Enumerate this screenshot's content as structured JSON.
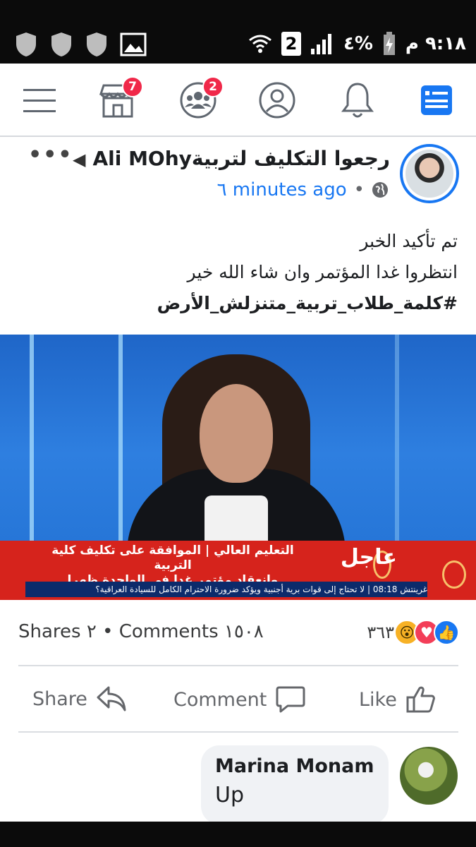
{
  "status_bar": {
    "time": "٩:١٨ م",
    "battery": "٤%",
    "sim": "2",
    "icons": [
      "shield-icon",
      "shield-icon",
      "shield-icon",
      "image-icon",
      "wifi-icon",
      "signal-icon",
      "battery-charging-icon"
    ]
  },
  "nav": {
    "icons": [
      "menu-icon",
      "marketplace-icon",
      "groups-icon",
      "profile-icon",
      "bell-icon",
      "news-feed-icon"
    ],
    "marketplace_badge": "7",
    "groups_badge": "2",
    "accent": "#1877f2"
  },
  "post": {
    "author": "Ali MOhy",
    "group": "رجعوا التكليف لتربية",
    "time": "٦ minutes ago",
    "text_line1": "تم تأكيد الخبر",
    "text_line2": "انتظروا غدا المؤتمر وان شاء الله خير",
    "hashtag": "#كلمة_طلاب_تربية_متنزلش_الأرض",
    "image": {
      "urgent_label": "عاجل",
      "headline_line1": "التعليم العالي | الموافقة على تكليف كلية التربية",
      "headline_line2": "وانعقاد مؤتمر غدا في الواحدة ظهرا",
      "ticker": "غرينتش 08:18 | لا تحتاج إلى قوات برية أجنبية ويؤكد ضرورة الاحترام الكامل للسيادة العراقية؟"
    },
    "reactions_count": "٣٦٣",
    "comments_text": "Comments ١٥٠٨",
    "shares_text": "Shares ٢",
    "separator": "•"
  },
  "actions": {
    "like": "Like",
    "comment": "Comment",
    "share": "Share"
  },
  "comment": {
    "name": "Marina Monam",
    "text": "Up"
  }
}
